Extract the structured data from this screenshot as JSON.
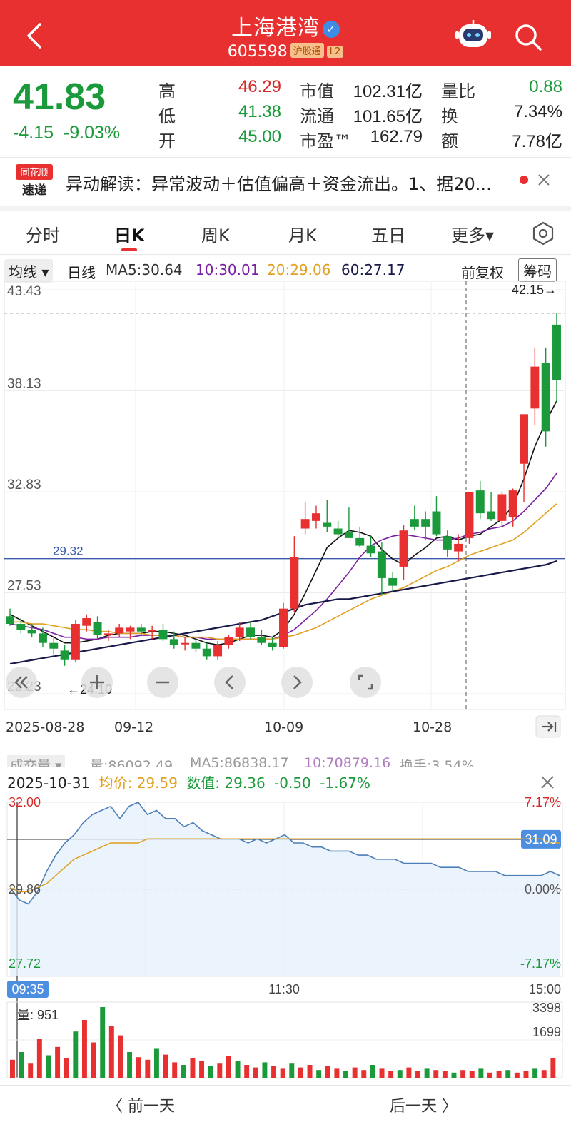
{
  "header": {
    "title": "上海港湾",
    "verified": "✓",
    "code": "605598",
    "tag_sgt": "沪股通",
    "tag_l2": "L2"
  },
  "quote": {
    "price": "41.83",
    "change": "-4.15",
    "change_pct": "-9.03%",
    "high_label": "高",
    "high": "46.29",
    "low_label": "低",
    "low": "41.38",
    "open_label": "开",
    "open": "45.00",
    "mcap_label": "市值",
    "mcap": "102.31亿",
    "float_label": "流通",
    "float": "101.65亿",
    "pe_label": "市盈™",
    "pe": "162.79",
    "vr_label": "量比",
    "vr": "0.88",
    "turn_label": "换",
    "turn": "7.34%",
    "amt_label": "额",
    "amt": "7.78亿"
  },
  "news": {
    "logo_top": "同花顺",
    "logo_bottom": "速递",
    "text": "异动解读：异常波动＋估值偏高＋资金流出。1、据20..."
  },
  "tabs": [
    "分时",
    "日K",
    "周K",
    "月K",
    "五日",
    "更多▾"
  ],
  "ma_row": {
    "select": "均线 ▾",
    "period": "日线",
    "ma5": "MA5:30.64",
    "ma10": "10:30.01",
    "ma20": "20:29.06",
    "ma60": "60:27.17",
    "adjust": "前复权",
    "chips": "筹码"
  },
  "kline": {
    "y_labels": [
      "43.43",
      "38.13",
      "32.83",
      "27.53",
      "22.23"
    ],
    "ref_price": "29.32",
    "high_mark": "42.15→",
    "low_mark": "←24.10",
    "dates": [
      "2025-08-28",
      "09-12",
      "10-09",
      "10-28"
    ]
  },
  "volume_row": {
    "label": "成交量 ▾",
    "vol": "量:86092.49",
    "ma5": "MA5:86838.17",
    "ma10": "10:70879.16",
    "turn": "换手:3.54%"
  },
  "intraday": {
    "date": "2025-10-31",
    "avg": "均价: 29.59",
    "value": "数值: 29.36",
    "chg": "-0.50",
    "pct": "-1.67%",
    "y_top": "32.00",
    "y_mid": "29.86",
    "y_bot": "27.72",
    "pct_top": "7.17%",
    "pct_mid": "0.00%",
    "pct_bot": "-7.17%",
    "price_tag": "31.09",
    "t_start": "09:35",
    "t_mid": "11:30",
    "t_end": "15:00",
    "vol_label": "量: 951",
    "vol_top": "3398",
    "vol_mid": "1699"
  },
  "footer": {
    "prev": "〈  前一天",
    "next": "后一天  〉"
  },
  "colors": {
    "up": "#e93030",
    "down": "#1a9a3a",
    "ma5": "#111111",
    "ma10": "#7b1fa2",
    "ma20": "#e0a020",
    "ma60": "#1a1a4a"
  },
  "chart_data": [
    {
      "type": "candlestick",
      "title": "",
      "yticks": [
        43.43,
        38.13,
        32.83,
        27.53,
        22.23
      ],
      "ylim": [
        22.23,
        43.43
      ],
      "x_ticks": [
        "2025-08-28",
        "09-12",
        "10-09",
        "10-28"
      ],
      "ohlc": [
        [
          26.3,
          26.7,
          25.8,
          25.9
        ],
        [
          25.9,
          26.2,
          25.4,
          25.6
        ],
        [
          25.6,
          25.9,
          25.2,
          25.4
        ],
        [
          25.4,
          25.7,
          24.7,
          24.9
        ],
        [
          24.9,
          25.2,
          24.3,
          24.6
        ],
        [
          24.5,
          24.8,
          23.7,
          24.0
        ],
        [
          24.0,
          26.1,
          23.9,
          25.9
        ],
        [
          25.8,
          26.4,
          25.5,
          26.2
        ],
        [
          26.0,
          26.3,
          25.1,
          25.3
        ],
        [
          25.3,
          25.6,
          25.0,
          25.4
        ],
        [
          25.4,
          25.9,
          25.2,
          25.7
        ],
        [
          25.5,
          25.8,
          25.1,
          25.7
        ],
        [
          25.7,
          25.9,
          25.3,
          25.5
        ],
        [
          25.5,
          25.8,
          25.1,
          25.6
        ],
        [
          25.6,
          25.9,
          25.0,
          25.1
        ],
        [
          25.1,
          25.5,
          24.6,
          24.8
        ],
        [
          24.9,
          25.2,
          24.5,
          24.9
        ],
        [
          24.9,
          25.2,
          24.4,
          24.6
        ],
        [
          24.6,
          24.9,
          24.0,
          24.2
        ],
        [
          24.2,
          25.0,
          24.0,
          24.8
        ],
        [
          24.8,
          25.3,
          24.6,
          25.2
        ],
        [
          25.2,
          26.0,
          25.0,
          25.7
        ],
        [
          25.7,
          26.0,
          25.1,
          25.2
        ],
        [
          25.2,
          25.6,
          24.8,
          24.9
        ],
        [
          24.9,
          25.2,
          24.5,
          24.7
        ],
        [
          24.7,
          27.0,
          24.6,
          26.7
        ],
        [
          26.7,
          30.5,
          26.5,
          29.4
        ],
        [
          30.9,
          32.3,
          30.6,
          31.4
        ],
        [
          31.3,
          32.1,
          30.9,
          31.7
        ],
        [
          31.2,
          32.4,
          30.7,
          31.0
        ],
        [
          30.9,
          31.3,
          30.4,
          30.6
        ],
        [
          30.7,
          32.0,
          30.4,
          30.4
        ],
        [
          30.4,
          31.0,
          29.9,
          30.0
        ],
        [
          30.0,
          30.5,
          29.4,
          29.6
        ],
        [
          29.7,
          30.2,
          27.4,
          28.3
        ],
        [
          28.3,
          28.6,
          27.6,
          27.9
        ],
        [
          28.9,
          31.1,
          28.2,
          30.8
        ],
        [
          31.4,
          32.1,
          30.8,
          31.0
        ],
        [
          31.4,
          31.8,
          30.3,
          31.0
        ],
        [
          31.8,
          32.6,
          30.5,
          30.6
        ],
        [
          30.5,
          30.8,
          29.4,
          29.8
        ],
        [
          29.7,
          30.6,
          29.2,
          30.1
        ],
        [
          30.4,
          32.6,
          30.1,
          32.8
        ],
        [
          32.9,
          33.4,
          31.4,
          31.7
        ],
        [
          31.8,
          32.8,
          31.3,
          31.4
        ],
        [
          31.3,
          32.8,
          31.0,
          32.7
        ],
        [
          31.5,
          33.0,
          31.0,
          32.9
        ],
        [
          34.3,
          35.7,
          32.3,
          36.9
        ],
        [
          37.2,
          40.4,
          36.3,
          39.4
        ],
        [
          39.6,
          40.4,
          35.2,
          36.0
        ],
        [
          41.6,
          42.2,
          37.5,
          38.7
        ]
      ],
      "ma": {
        "MA5": [
          26.4,
          26.1,
          25.8,
          25.5,
          25.2,
          24.9,
          24.9,
          25.0,
          25.1,
          25.3,
          25.4,
          25.4,
          25.4,
          25.5,
          25.5,
          25.4,
          25.3,
          25.1,
          24.9,
          24.8,
          24.9,
          25.1,
          25.3,
          25.3,
          25.2,
          25.6,
          26.4,
          27.5,
          28.7,
          29.9,
          30.4,
          30.8,
          30.7,
          30.5,
          29.8,
          29.3,
          29.0,
          29.5,
          29.9,
          30.4,
          30.5,
          30.3,
          30.5,
          30.6,
          31.0,
          31.4,
          32.1,
          33.5,
          35.2,
          36.5,
          37.6
        ],
        "MA10": [
          25.9,
          25.8,
          25.7,
          25.6,
          25.4,
          25.2,
          25.2,
          25.1,
          25.1,
          25.2,
          25.2,
          25.2,
          25.3,
          25.3,
          25.3,
          25.3,
          25.2,
          25.2,
          25.1,
          25.1,
          25.1,
          25.1,
          25.1,
          25.1,
          25.1,
          25.3,
          25.6,
          26.1,
          26.6,
          27.2,
          27.9,
          28.6,
          29.4,
          30.0,
          30.3,
          30.5,
          30.6,
          30.5,
          30.4,
          30.3,
          30.3,
          30.4,
          30.6,
          30.7,
          30.9,
          31.0,
          31.3,
          31.8,
          32.4,
          33.0,
          33.8
        ],
        "MA20": [
          26.0,
          26.0,
          25.9,
          25.9,
          25.8,
          25.7,
          25.6,
          25.6,
          25.5,
          25.5,
          25.4,
          25.4,
          25.4,
          25.3,
          25.3,
          25.3,
          25.2,
          25.2,
          25.2,
          25.1,
          25.1,
          25.1,
          25.1,
          25.1,
          25.1,
          25.2,
          25.3,
          25.5,
          25.7,
          26.0,
          26.3,
          26.6,
          26.9,
          27.2,
          27.4,
          27.6,
          27.8,
          28.1,
          28.4,
          28.7,
          28.9,
          29.2,
          29.5,
          29.7,
          29.9,
          30.1,
          30.3,
          30.7,
          31.2,
          31.7,
          32.2
        ],
        "MA60": [
          23.8,
          23.9,
          24.0,
          24.1,
          24.2,
          24.3,
          24.4,
          24.5,
          24.6,
          24.7,
          24.8,
          24.9,
          25.0,
          25.1,
          25.2,
          25.3,
          25.4,
          25.5,
          25.6,
          25.7,
          25.8,
          25.9,
          26.0,
          26.1,
          26.3,
          26.5,
          26.7,
          26.9,
          27.0,
          27.1,
          27.2,
          27.2,
          27.3,
          27.4,
          27.5,
          27.6,
          27.7,
          27.8,
          27.9,
          28.0,
          28.1,
          28.2,
          28.3,
          28.4,
          28.5,
          28.6,
          28.7,
          28.8,
          28.9,
          29.0,
          29.2
        ]
      }
    },
    {
      "type": "line",
      "title": "",
      "xlabel_ticks": [
        "09:35",
        "11:30",
        "15:00"
      ],
      "ylim": [
        27.72,
        32.0
      ],
      "series": [
        {
          "values": [
            29.9,
            29.6,
            29.5,
            29.8,
            30.3,
            30.7,
            31.0,
            31.2,
            31.5,
            31.7,
            31.8,
            31.9,
            31.6,
            31.9,
            32.0,
            31.7,
            31.8,
            31.6,
            31.6,
            31.4,
            31.5,
            31.3,
            31.2,
            31.1,
            31.1,
            31.1,
            31.0,
            31.1,
            31.0,
            31.1,
            31.2,
            31.0,
            31.0,
            30.9,
            30.9,
            30.8,
            30.8,
            30.8,
            30.7,
            30.7,
            30.6,
            30.6,
            30.6,
            30.5,
            30.5,
            30.5,
            30.5,
            30.4,
            30.4,
            30.4,
            30.3,
            30.3,
            30.3,
            30.3,
            30.2,
            30.2,
            30.2,
            30.2,
            30.2,
            30.3,
            30.2
          ]
        },
        {
          "values": [
            29.9,
            29.8,
            29.8,
            29.9,
            30.0,
            30.2,
            30.4,
            30.6,
            30.7,
            30.8,
            30.9,
            31.0,
            31.0,
            31.0,
            31.0,
            31.1,
            31.1,
            31.1,
            31.1,
            31.1,
            31.1,
            31.1,
            31.1,
            31.1,
            31.1,
            31.1,
            31.1,
            31.1,
            31.1,
            31.1,
            31.1,
            31.1,
            31.1,
            31.1,
            31.1,
            31.1,
            31.1,
            31.1,
            31.1,
            31.1,
            31.1,
            31.1,
            31.1,
            31.1,
            31.1,
            31.1,
            31.1,
            31.1,
            31.1,
            31.1,
            31.1,
            31.1,
            31.1,
            31.1,
            31.1,
            31.1,
            31.1,
            31.1,
            31.1,
            31.0,
            31.0
          ]
        }
      ]
    }
  ]
}
